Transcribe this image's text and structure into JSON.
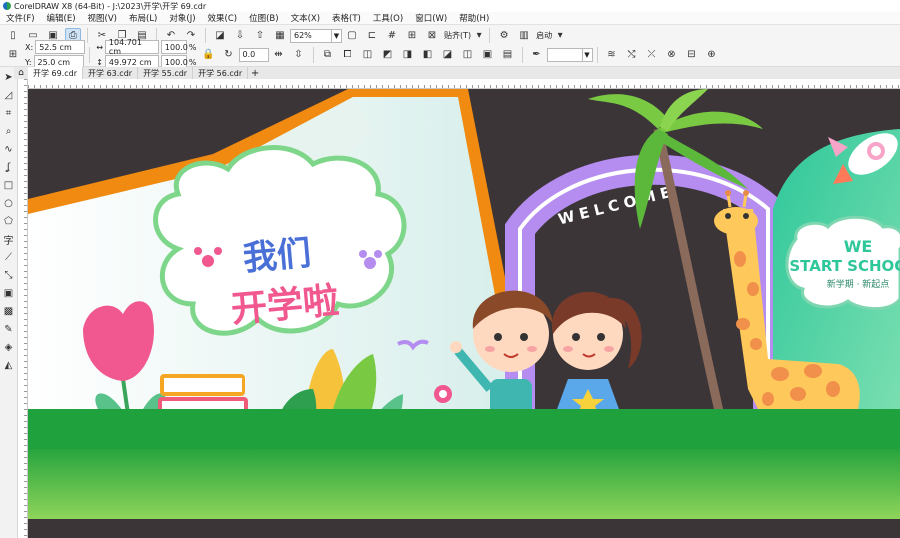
{
  "window": {
    "title": "CorelDRAW X8 (64-Bit) - J:\\2023\\开学\\开学 69.cdr"
  },
  "menu": [
    "文件(F)",
    "编辑(E)",
    "视图(V)",
    "布局(L)",
    "对象(J)",
    "效果(C)",
    "位图(B)",
    "文本(X)",
    "表格(T)",
    "工具(O)",
    "窗口(W)",
    "帮助(H)"
  ],
  "toolbar": {
    "zoom": "62%",
    "snap_label": "贴齐(T)",
    "launch_label": "启动"
  },
  "props": {
    "x_label": "X:",
    "x": "52.5 cm",
    "y_label": "Y:",
    "y": "25.0 cm",
    "w": "104.701 cm",
    "h": "49.972 cm",
    "sx": "100.0",
    "sy": "100.0",
    "pct": "%",
    "angle": "0.0",
    "outline": ""
  },
  "tabs": [
    "开学 69.cdr",
    "开学 63.cdr",
    "开学 55.cdr",
    "开学 56.cdr"
  ],
  "artwork": {
    "headline_top": "我们",
    "headline_bottom": "开学啦",
    "arch_text": "WELCOME",
    "panel_line1": "WE",
    "panel_line2": "START SCHOOL",
    "panel_line3": "新学期 · 新起点"
  },
  "colors": {
    "board_bg": "#3c3538",
    "grass": "#1fa23d",
    "book_orange": "#f08a10",
    "cloud_border": "#7ed68a",
    "arch": "#b58df0",
    "headline_blue": "#4a6fd6",
    "headline_pink": "#f0588f"
  }
}
